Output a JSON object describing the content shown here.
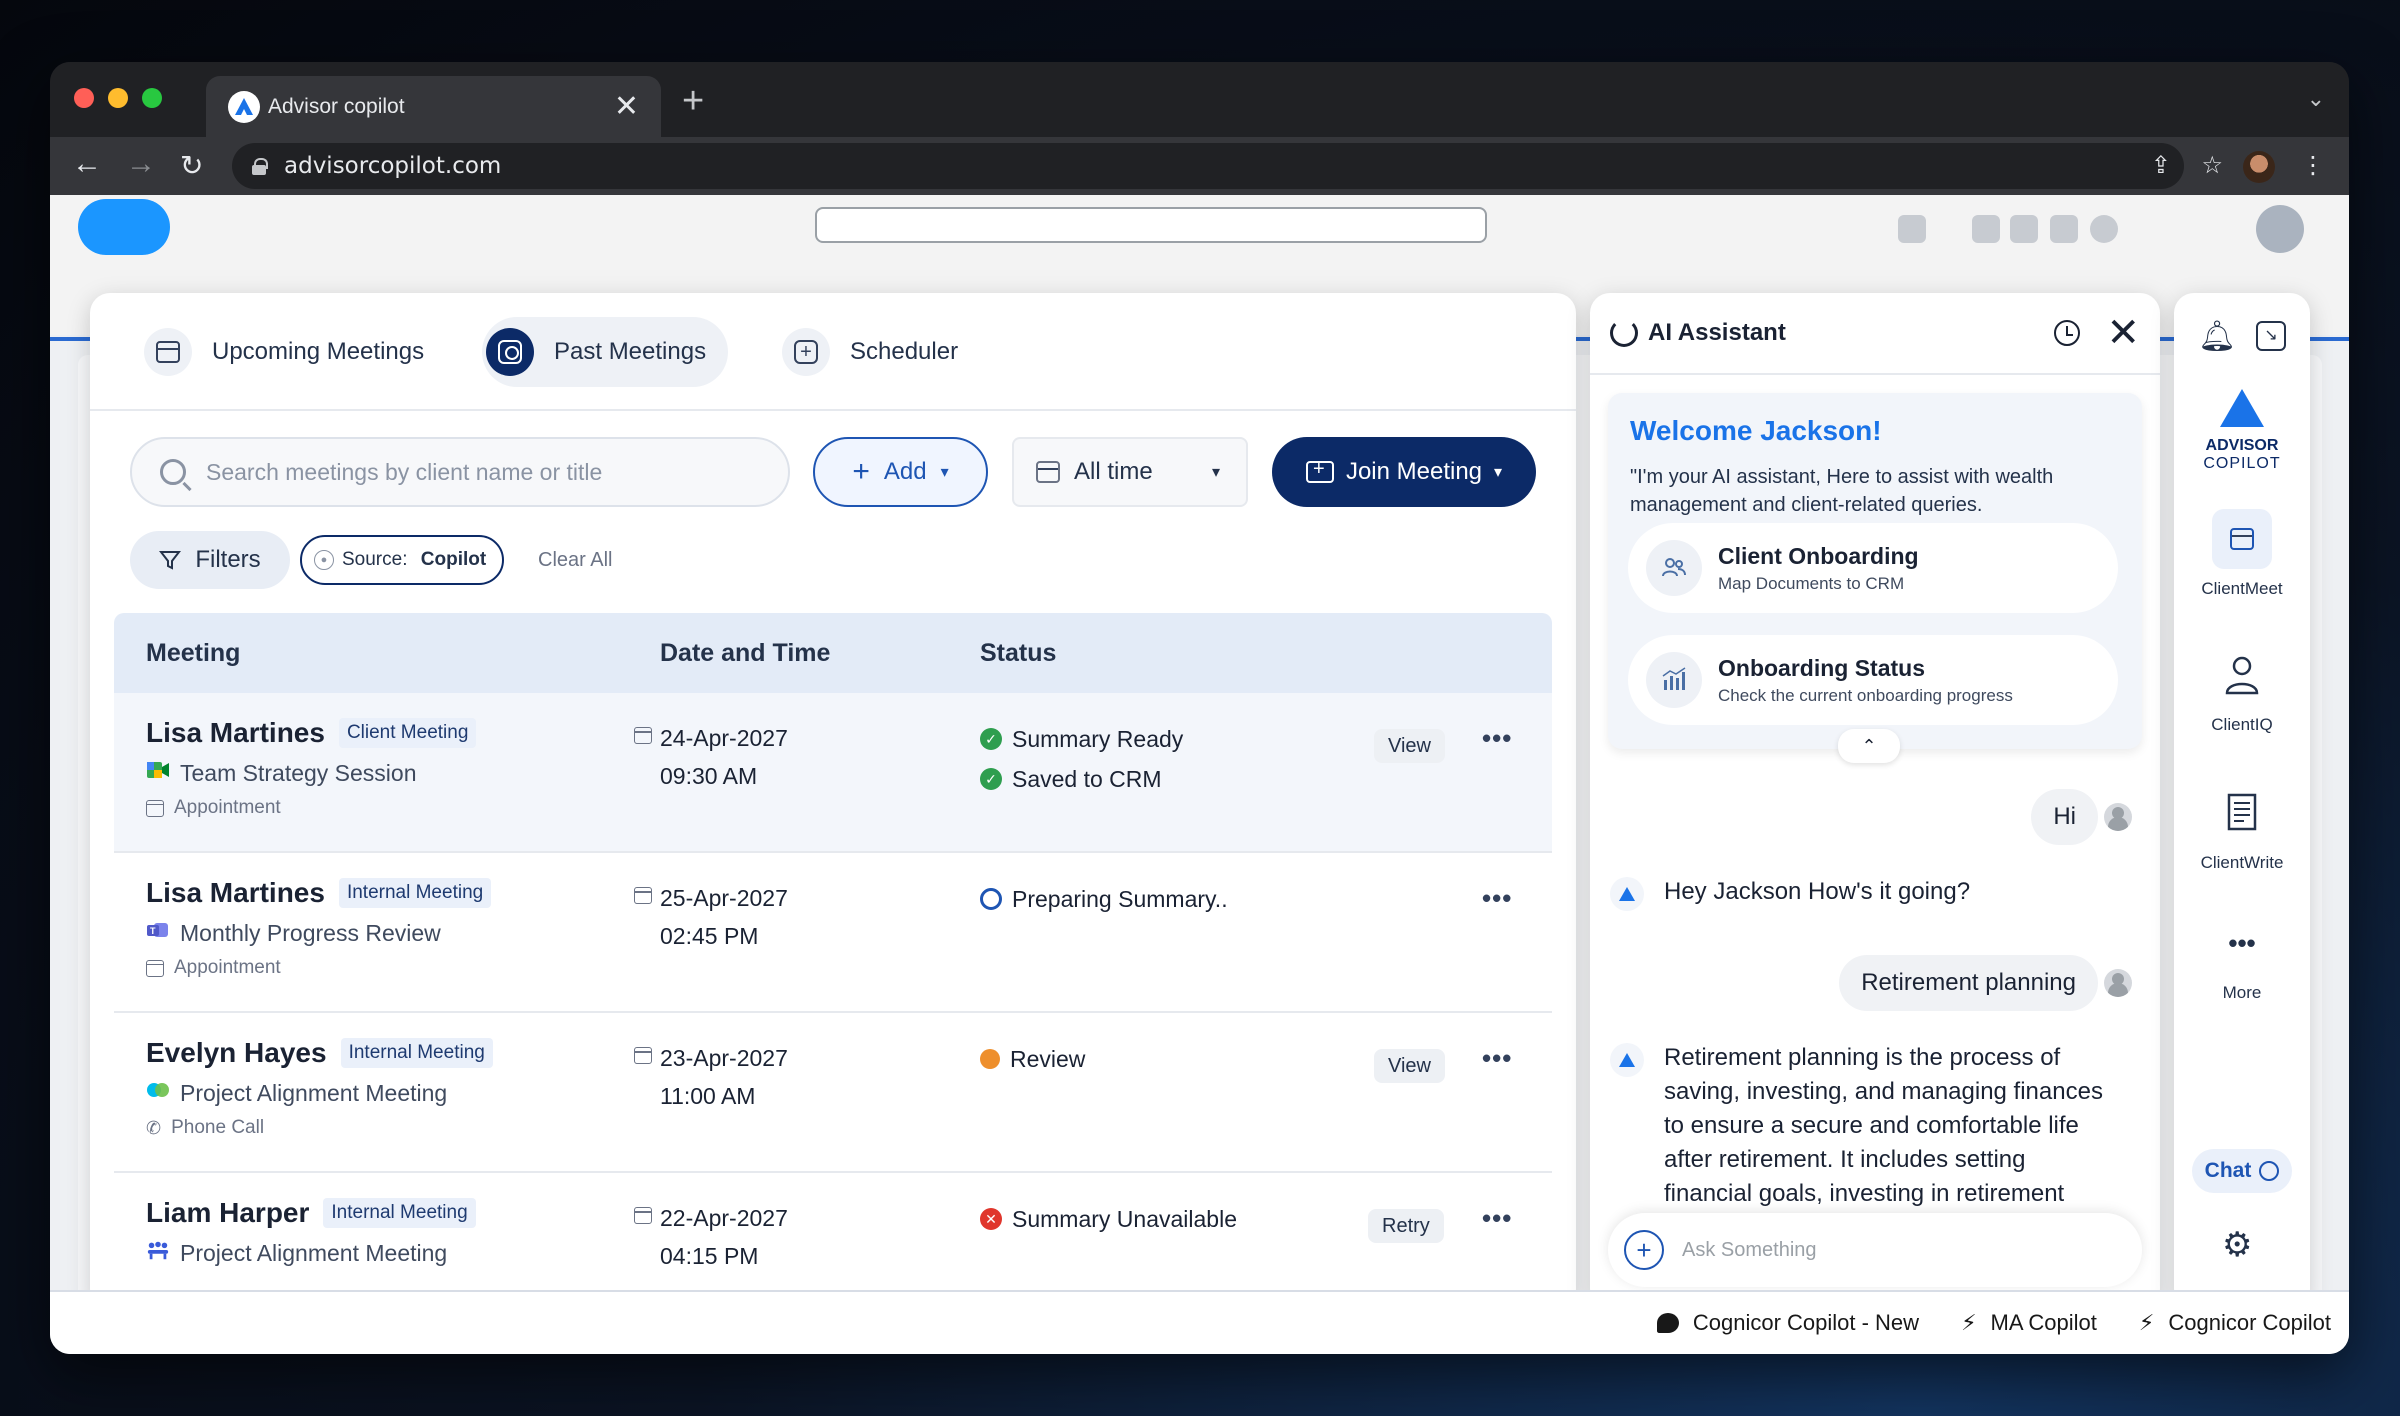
{
  "browser": {
    "tab_title": "Advisor copilot",
    "url": "advisorcopilot.com",
    "new_tab": "+",
    "close_tab": "✕"
  },
  "meetings": {
    "tabs": [
      {
        "label": "Upcoming Meetings",
        "icon": "calendar-icon",
        "active": false
      },
      {
        "label": "Past Meetings",
        "icon": "history-icon",
        "active": true
      },
      {
        "label": "Scheduler",
        "icon": "plus-box-icon",
        "active": false
      }
    ],
    "search_placeholder": "Search meetings by client name or title",
    "add_label": "Add",
    "time_filter": "All time",
    "join_label": "Join Meeting",
    "filters_label": "Filters",
    "source_prefix": "Source: ",
    "source_value": "Copilot",
    "clear_all": "Clear All",
    "columns": [
      "Meeting",
      "Date and Time",
      "Status"
    ],
    "rows": [
      {
        "client": "Lisa Martines",
        "type": "Client Meeting",
        "title": "Team Strategy Session",
        "app_icon": "google-meet-icon",
        "kind": "Appointment",
        "date": "24-Apr-2027",
        "time": "09:30 AM",
        "statuses": [
          {
            "text": "Summary Ready",
            "kind": "ok"
          },
          {
            "text": "Saved to CRM",
            "kind": "ok"
          }
        ],
        "action": "View"
      },
      {
        "client": "Lisa Martines",
        "type": "Internal Meeting",
        "title": "Monthly Progress Review",
        "app_icon": "teams-icon",
        "kind": "Appointment",
        "date": "25-Apr-2027",
        "time": "02:45 PM",
        "statuses": [
          {
            "text": "Preparing Summary..",
            "kind": "prep"
          }
        ],
        "action": ""
      },
      {
        "client": "Evelyn Hayes",
        "type": "Internal Meeting",
        "title": "Project Alignment Meeting",
        "app_icon": "webex-icon",
        "kind": "Phone Call",
        "date": "23-Apr-2027",
        "time": "11:00 AM",
        "statuses": [
          {
            "text": "Review",
            "kind": "review"
          }
        ],
        "action": "View"
      },
      {
        "client": "Liam Harper",
        "type": "Internal Meeting",
        "title": "Project Alignment Meeting",
        "app_icon": "group-meeting-icon",
        "kind": "",
        "date": "22-Apr-2027",
        "time": "04:15 PM",
        "statuses": [
          {
            "text": "Summary Unavailable",
            "kind": "error"
          }
        ],
        "action": "Retry"
      }
    ],
    "more_label": "•••"
  },
  "assistant": {
    "title": "AI Assistant",
    "welcome_title": "Welcome Jackson!",
    "welcome_text": "\"I'm your AI assistant, Here to assist with wealth management and client-related queries.",
    "quick_actions": [
      {
        "title": "Client Onboarding",
        "subtitle": "Map Documents to CRM",
        "icon": "people-icon"
      },
      {
        "title": "Onboarding Status",
        "subtitle": "Check the current onboarding progress",
        "icon": "bar-chart-icon"
      }
    ],
    "messages": [
      {
        "from": "user",
        "text": "Hi"
      },
      {
        "from": "bot",
        "text": "Hey Jackson How's it going?"
      },
      {
        "from": "user",
        "text": "Retirement planning"
      },
      {
        "from": "bot",
        "text": "Retirement planning is the process of saving, investing, and managing finances to ensure a secure and comfortable life after retirement. It includes setting financial goals, investing in retirement"
      }
    ],
    "input_placeholder": "Ask Something"
  },
  "rail": {
    "brand_line1": "ADVISOR",
    "brand_line2": "COPILOT",
    "items": [
      {
        "label": "ClientMeet",
        "icon": "calendar-icon",
        "active": true
      },
      {
        "label": "ClientIQ",
        "icon": "person-icon",
        "active": false
      },
      {
        "label": "ClientWrite",
        "icon": "document-icon",
        "active": false
      },
      {
        "label": "More",
        "icon": "more-icon",
        "active": false
      }
    ],
    "chat_label": "Chat"
  },
  "footer": {
    "items": [
      "Cognicor Copilot - New",
      "MA Copilot",
      "Cognicor Copilot"
    ]
  },
  "colors": {
    "primary": "#0c2a67",
    "accent": "#1a73e8",
    "ok": "#2e9e4f",
    "warning": "#ee8f2c",
    "error": "#e0362c"
  }
}
